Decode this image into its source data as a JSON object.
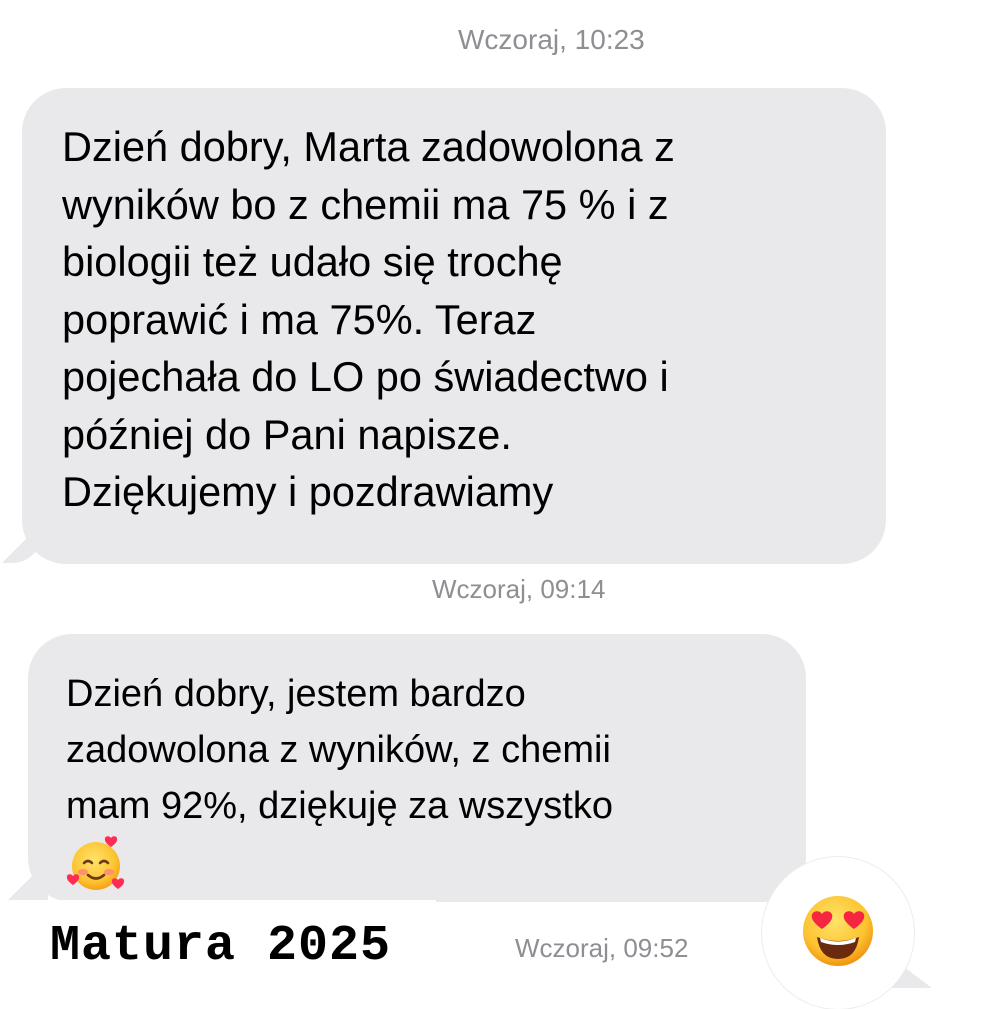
{
  "messages": [
    {
      "timestamp": "Wczoraj, 10:23",
      "text": "Dzień dobry, Marta zadowolona z\nwyników bo z chemii ma 75 % i z\nbiologii też udało się trochę\npoprawić i ma 75%. Teraz\npojechała do LO po świadectwo i\npóźniej do Pani napisze.\nDziękujemy i pozdrawiamy"
    },
    {
      "timestamp": "Wczoraj, 09:14",
      "text": "Dzień dobry, jestem bardzo\nzadowolona z wyników, z chemii\nmam 92%, dziękuję za wszystko",
      "emoji_icon": "smiling-face-with-hearts-icon"
    },
    {
      "timestamp": "Wczoraj, 09:52",
      "reaction_icon": "heart-eyes-face-icon"
    }
  ],
  "caption": "Matura 2025",
  "colors": {
    "bubble": "#e9e9eb",
    "timestamp": "#8e8e93",
    "background": "#ffffff"
  }
}
